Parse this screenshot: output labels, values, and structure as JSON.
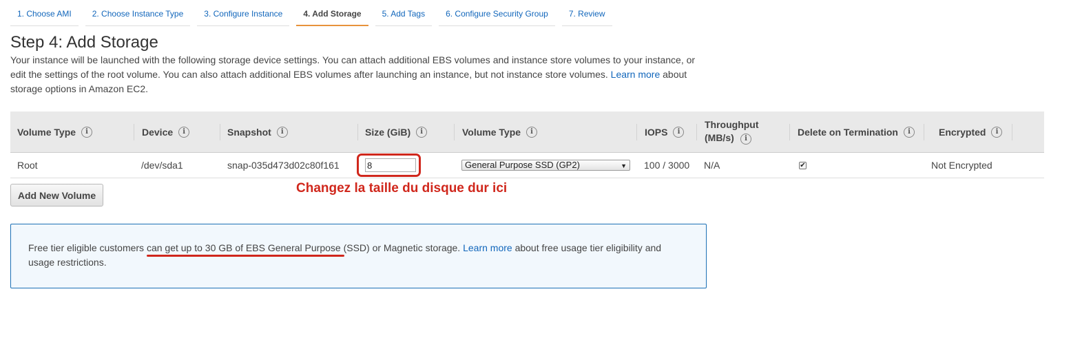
{
  "tabs": [
    {
      "label": "1. Choose AMI",
      "active": false
    },
    {
      "label": "2. Choose Instance Type",
      "active": false
    },
    {
      "label": "3. Configure Instance",
      "active": false
    },
    {
      "label": "4. Add Storage",
      "active": true
    },
    {
      "label": "5. Add Tags",
      "active": false
    },
    {
      "label": "6. Configure Security Group",
      "active": false
    },
    {
      "label": "7. Review",
      "active": false
    }
  ],
  "page": {
    "title": "Step 4: Add Storage",
    "desc_part1": "Your instance will be launched with the following storage device settings. You can attach additional EBS volumes and instance store volumes to your instance, or edit the settings of the root volume. You can also attach additional EBS volumes after launching an instance, but not instance store volumes.",
    "desc_link": "Learn more",
    "desc_part2": "about storage options in Amazon EC2."
  },
  "table": {
    "headers": {
      "volume_type": "Volume Type",
      "device": "Device",
      "snapshot": "Snapshot",
      "size": "Size (GiB)",
      "volume_type2": "Volume Type",
      "iops": "IOPS",
      "throughput": "Throughput (MB/s)",
      "delete_on_termination": "Delete on Termination",
      "encrypted": "Encrypted"
    },
    "row": {
      "volume_type": "Root",
      "device": "/dev/sda1",
      "snapshot": "snap-035d473d02c80f161",
      "size": "8",
      "volume_type_select": "General Purpose SSD (GP2)",
      "iops": "100 / 3000",
      "throughput": "N/A",
      "delete_on_termination": true,
      "encrypted": "Not Encrypted"
    }
  },
  "add_volume_label": "Add New Volume",
  "annotation": "Changez la taille du disque dur ici",
  "info": {
    "text1": "Free tier eligible customers can get up to 30 GB of EBS General Purpose (SSD) or Magnetic storage.",
    "link": "Learn more",
    "text2": "about free usage tier eligibility and usage restrictions."
  },
  "icons": {
    "info": "info-icon",
    "check": "checkmark-icon",
    "select_arrow": "triangle-down-icon"
  },
  "colors": {
    "link": "#1166bb",
    "active_tab_underline": "#e7923b",
    "annotation_red": "#d0271c",
    "info_border": "#1a6fb5",
    "info_bg": "#f2f8fd",
    "table_header_bg": "#e9e9e9"
  }
}
